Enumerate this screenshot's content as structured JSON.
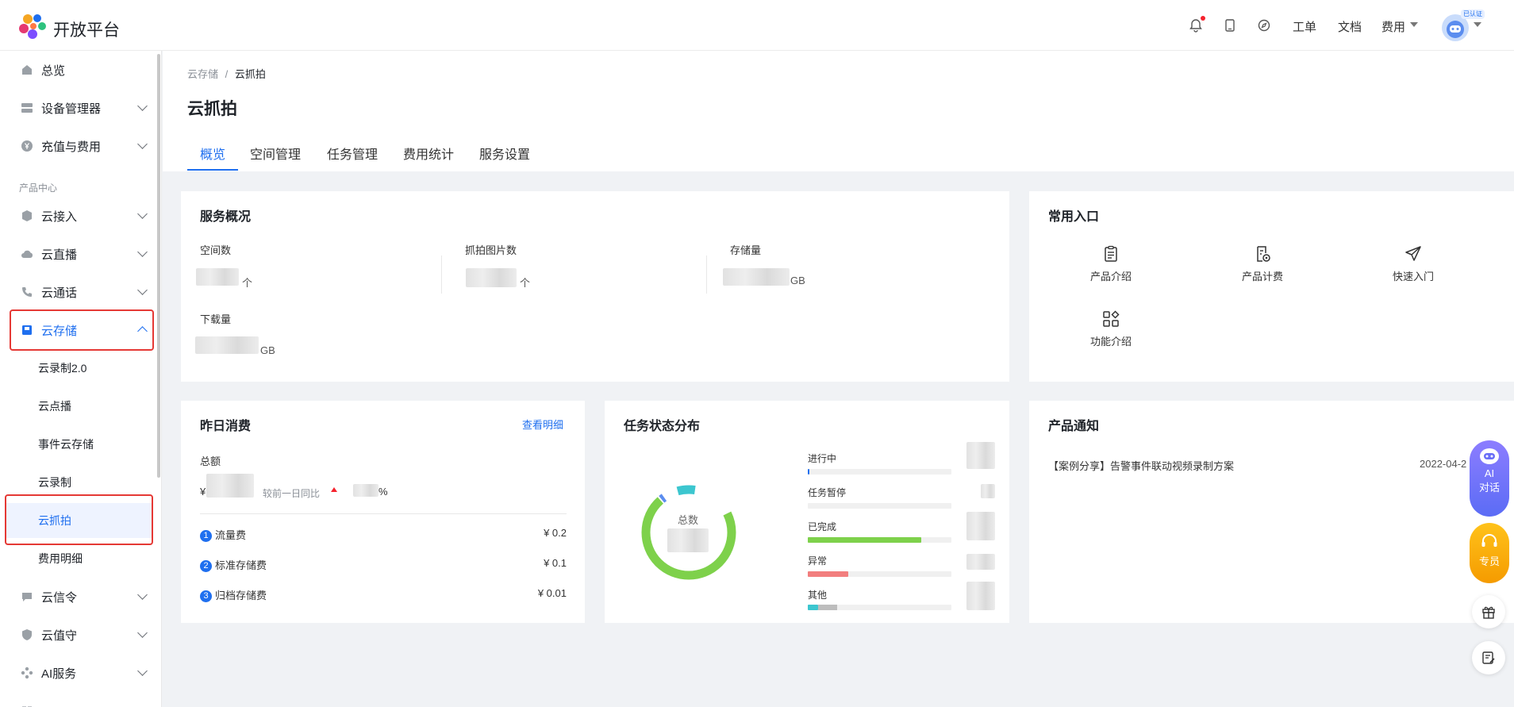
{
  "header": {
    "logo_text": "开放平台",
    "links": {
      "workorder": "工单",
      "docs": "文档",
      "fees": "费用"
    },
    "avatar_badge": "已认证"
  },
  "sidebar": {
    "overview": "总览",
    "device_manager": "设备管理器",
    "recharge": "充值与费用",
    "section_label": "产品中心",
    "cloud_access": "云接入",
    "cloud_live": "云直播",
    "cloud_call": "云通话",
    "cloud_storage": "云存储",
    "sub_items": [
      "云录制2.0",
      "云点播",
      "事件云存储",
      "云录制",
      "云抓拍",
      "费用明细"
    ],
    "cloud_signal": "云信令",
    "cloud_guard": "云值守",
    "ai_service": "AI服务"
  },
  "breadcrumb": {
    "parent": "云存储",
    "sep": "/",
    "current": "云抓拍"
  },
  "page_title": "云抓拍",
  "tabs": [
    "概览",
    "空间管理",
    "任务管理",
    "费用统计",
    "服务设置"
  ],
  "service_overview": {
    "title": "服务概况",
    "space_count_label": "空间数",
    "space_unit": "个",
    "snap_count_label": "抓拍图片数",
    "snap_unit": "个",
    "storage_label": "存储量",
    "storage_unit": "GB",
    "download_label": "下载量",
    "download_unit": "GB"
  },
  "quick_entry": {
    "title": "常用入口",
    "items": [
      "产品介绍",
      "产品计费",
      "快速入门",
      "功能介绍"
    ]
  },
  "yesterday": {
    "title": "昨日消费",
    "detail_link": "查看明细",
    "total_label": "总额",
    "currency": "¥",
    "compare_label": "较前一日同比",
    "percent": "%",
    "items": [
      {
        "num": "1",
        "name": "流量费",
        "value": "¥ 0.2"
      },
      {
        "num": "2",
        "name": "标准存储费",
        "value": "¥ 0.1"
      },
      {
        "num": "3",
        "name": "归档存储费",
        "value": "¥ 0.01"
      }
    ]
  },
  "task_status": {
    "title": "任务状态分布",
    "donut_label": "总数",
    "statuses": [
      {
        "name": "进行中",
        "color": "#1f6fef",
        "fraction": 0.01
      },
      {
        "name": "任务暂停",
        "color": "#bdbdbd",
        "fraction": 0.0
      },
      {
        "name": "已完成",
        "color": "#7ed14b",
        "fraction": 0.79
      },
      {
        "name": "异常",
        "color": "#f27e7e",
        "fraction": 0.28
      },
      {
        "name": "其他",
        "color": "#3cc6cf",
        "fraction": 0.07
      }
    ]
  },
  "notice": {
    "title": "产品通知",
    "items": [
      {
        "text": "【案例分享】告警事件联动视频录制方案",
        "date": "2022-04-2"
      }
    ]
  },
  "float": {
    "ai_line1": "AI",
    "ai_line2": "对话",
    "expert": "专员"
  }
}
